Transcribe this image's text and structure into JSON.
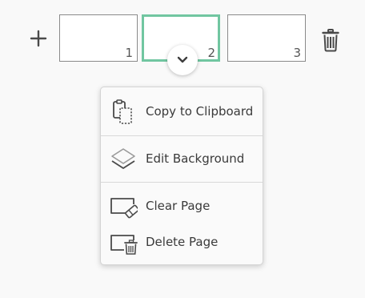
{
  "toolbar": {
    "add_icon": "plus-icon",
    "delete_icon": "trash-icon"
  },
  "pages": [
    {
      "number": "1",
      "selected": false
    },
    {
      "number": "2",
      "selected": true
    },
    {
      "number": "3",
      "selected": false
    }
  ],
  "page_menu_toggle_icon": "chevron-down-icon",
  "page_menu": {
    "items": [
      {
        "label": "Copy to Clipboard",
        "icon": "clipboard-copy-icon"
      },
      {
        "label": "Edit Background",
        "icon": "layers-icon"
      },
      {
        "label": "Clear Page",
        "icon": "eraser-page-icon"
      },
      {
        "label": "Delete Page",
        "icon": "delete-page-icon"
      }
    ]
  },
  "colors": {
    "selected_border": "#71c6a1",
    "icon": "#4a4a4a",
    "background": "#f9f9f9"
  }
}
